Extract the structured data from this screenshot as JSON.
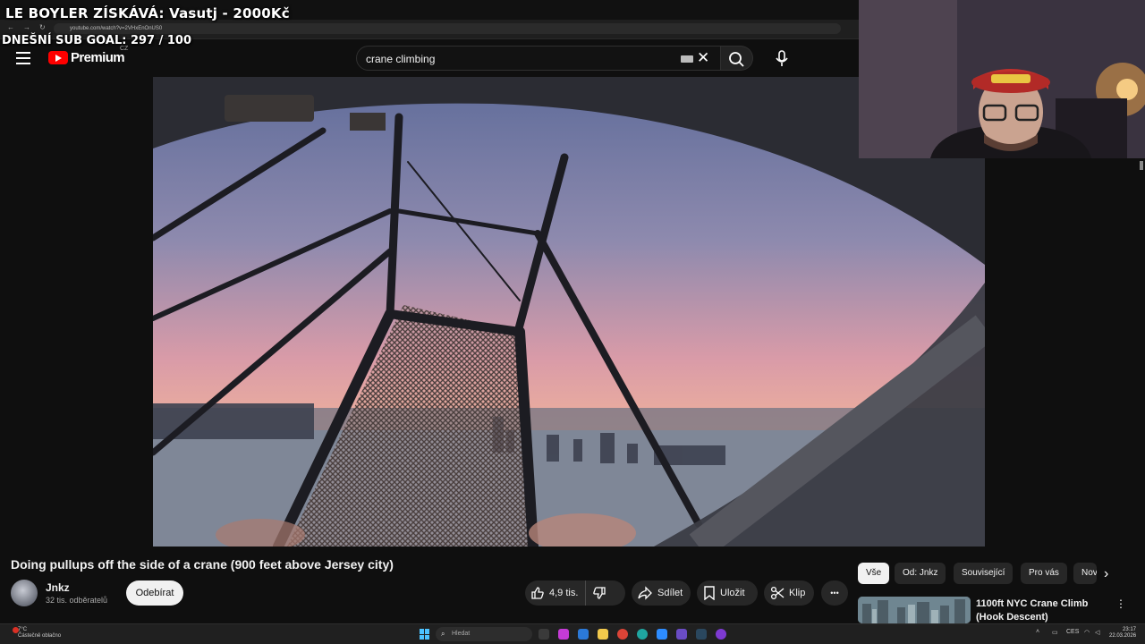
{
  "browser": {
    "url": "youtube.com/watch?v=2VHxEnOnUS0"
  },
  "overlay": {
    "title": "LE BOYLER ZÍSKÁVÁ: Vasutj - 2000Kč",
    "goal": "DNEŠNÍ SUB GOAL: 297 / 100"
  },
  "masthead": {
    "logo_text": "Premium",
    "country_code": "CZ",
    "search_value": "crane climbing",
    "icons": [
      "menu-icon",
      "youtube-logo-icon",
      "keyboard-icon",
      "close-icon",
      "search-icon",
      "mic-icon"
    ]
  },
  "video": {
    "title": "Doing pullups off the side of a crane (900 feet above Jersey city)",
    "channel_name": "Jnkz",
    "subscribers": "32 tis. odběratelů",
    "subscribe_label": "Odebírat",
    "likes": "4,9 tis.",
    "share_label": "Sdílet",
    "save_label": "Uložit",
    "clip_label": "Klip",
    "more_label": "•••"
  },
  "chips": [
    {
      "label": "Vše",
      "active": true
    },
    {
      "label": "Od: Jnkz",
      "active": false
    },
    {
      "label": "Související",
      "active": false
    },
    {
      "label": "Pro vás",
      "active": false
    },
    {
      "label": "Nové",
      "active": false
    }
  ],
  "recommendation": {
    "title": "1100ft NYC Crane Climb (Hook Descent)"
  },
  "taskbar": {
    "weather_temp": "7°C",
    "weather_desc": "Částečně oblačno",
    "search_placeholder": "Hledat",
    "language": "CES",
    "time": "23:17",
    "date": "22.03.2026"
  },
  "colors": {
    "background": "#0f0f0f",
    "youtube_red": "#ff0000",
    "pill": "#272727",
    "windows_accent": "#4cc2ff"
  }
}
